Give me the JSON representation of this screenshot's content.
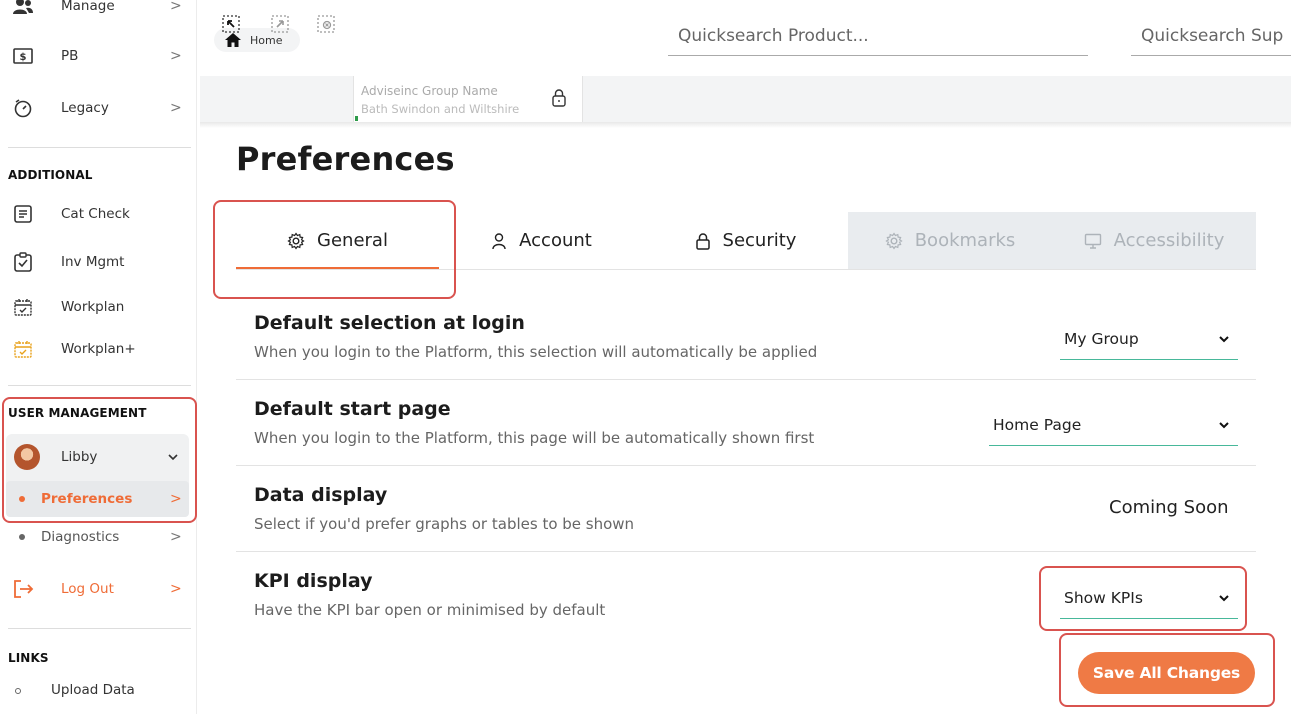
{
  "sidebar": {
    "items_top": [
      {
        "label": "Manage",
        "icon": "users-icon"
      },
      {
        "label": "PB",
        "icon": "dollar-box-icon"
      },
      {
        "label": "Legacy",
        "icon": "timer-icon"
      }
    ],
    "additional_heading": "ADDITIONAL",
    "additional_items": [
      {
        "label": "Cat Check",
        "icon": "document-list-icon"
      },
      {
        "label": "Inv Mgmt",
        "icon": "clipboard-check-icon"
      },
      {
        "label": "Workplan",
        "icon": "calendar-check-icon"
      },
      {
        "label": "Workplan+",
        "icon": "calendar-plus-icon"
      }
    ],
    "user_management_heading": "USER MANAGEMENT",
    "user_name": "Libby",
    "preferences_label": "Preferences",
    "diagnostics_label": "Diagnostics",
    "logout_label": "Log Out",
    "links_heading": "LINKS",
    "upload_label": "Upload Data",
    "chevron": ">"
  },
  "topbar": {
    "home_label": "Home",
    "quicksearch_product_placeholder": "Quicksearch Product...",
    "quicksearch_supplier_placeholder": "Quicksearch Sup",
    "group_name_label": "Adviseinc Group Name",
    "group_subtitle": "Bath Swindon and Wiltshire"
  },
  "page": {
    "title": "Preferences",
    "tabs": [
      {
        "label": "General",
        "icon": "gear-icon",
        "active": true
      },
      {
        "label": "Account",
        "icon": "user-icon"
      },
      {
        "label": "Security",
        "icon": "lock-icon"
      },
      {
        "label": "Bookmarks",
        "icon": "gear-icon",
        "disabled": true
      },
      {
        "label": "Accessibility",
        "icon": "monitor-icon",
        "disabled": true
      }
    ],
    "settings": {
      "login": {
        "title": "Default selection at login",
        "desc": "When you login to the Platform, this selection will automatically be applied",
        "value": "My Group"
      },
      "start": {
        "title": "Default start page",
        "desc": "When you login to the Platform, this page will be automatically shown first",
        "value": "Home Page"
      },
      "data": {
        "title": "Data display",
        "desc": "Select if you'd prefer graphs or tables to be shown",
        "value": "Coming Soon"
      },
      "kpi": {
        "title": "KPI display",
        "desc": "Have the KPI bar open or minimised by default",
        "value": "Show KPIs"
      }
    },
    "save_label": "Save All Changes"
  },
  "colors": {
    "accent": "#ef6c37",
    "highlight_box": "#d9534f",
    "select_underline": "#48b89a"
  }
}
